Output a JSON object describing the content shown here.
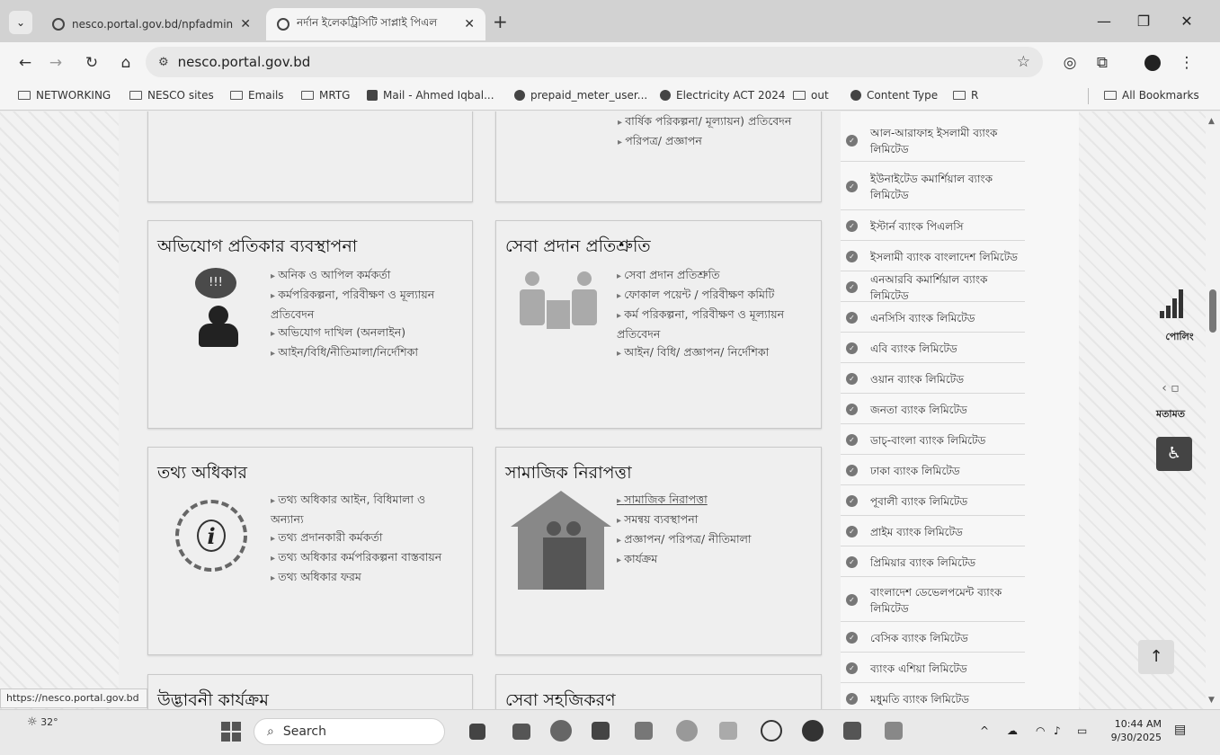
{
  "browser": {
    "tabs": [
      {
        "title": "nesco.portal.gov.bd/npfadmin/"
      },
      {
        "title": "নর্দান ইলেকট্রিসিটি সাপ্লাই পিএল"
      }
    ],
    "new_tab": "+",
    "address": "nesco.portal.gov.bd",
    "bookmarks": [
      "NETWORKING",
      "NESCO sites",
      "Emails",
      "MRTG",
      "Mail - Ahmed Iqbal...",
      "prepaid_meter_user...",
      "Electricity ACT 2024",
      "out",
      "Content Type",
      "R",
      "All Bookmarks"
    ],
    "status_url": "https://nesco.portal.gov.bd"
  },
  "page": {
    "card_top_mid_items": [
      "বার্ষিক পরিকল্পনা/ মূল্যায়ন) প্রতিবেদন",
      "পরিপত্র/ প্রজ্ঞাপন"
    ],
    "card_grievance": {
      "title": "অভিযোগ প্রতিকার ব্যবস্থাপনা",
      "items": [
        "অনিক ও আপিল কর্মকর্তা",
        "কর্মপরিকল্পনা, পরিবীক্ষণ ও মূল্যায়ন প্রতিবেদন",
        "অভিযোগ দাখিল (অনলাইন)",
        "আইন/বিধি/নীতিমালা/নির্দেশিকা"
      ]
    },
    "card_citizen_charter": {
      "title": "সেবা প্রদান প্রতিশ্রুতি",
      "items": [
        "সেবা প্রদান প্রতিশ্রুতি",
        "ফোকাল পয়েন্ট / পরিবীক্ষণ কমিটি",
        "কর্ম পরিকল্পনা, পরিবীক্ষণ ও মূল্যায়ন প্রতিবেদন",
        "আইন/ বিধি/ প্রজ্ঞাপন/ নির্দেশিকা"
      ]
    },
    "card_rti": {
      "title": "তথ্য অধিকার",
      "items": [
        "তথ্য অধিকার আইন, বিধিমালা ও অন্যান্য",
        "তথ্য প্রদানকারী কর্মকর্তা",
        "তথ্য অধিকার কর্মপরিকল্পনা বাস্তবায়ন",
        "তথ্য অধিকার ফরম"
      ]
    },
    "card_social_safety": {
      "title": "সামাজিক নিরাপত্তা",
      "items": [
        "সামাজিক নিরাপত্তা",
        "সমন্বয় ব্যবস্থাপনা",
        "প্রজ্ঞাপন/ পরিপত্র/ নীতিমালা",
        "কার্যক্রম"
      ]
    },
    "card_innovation": {
      "title": "উদ্ভাবনী কার্যক্রম"
    },
    "card_service_simplify": {
      "title": "সেবা সহজিকরণ"
    },
    "banks": [
      "আল-আরাফাহ ইসলামী ব্যাংক লিমিটেড",
      "ইউনাইটেড কমার্শিয়াল ব্যাংক লিমিটেড",
      "ইস্টার্ন ব্যাংক পিএলসি",
      "ইসলামী ব্যাংক বাংলাদেশ লিমিটেড",
      "এনআরবি কমার্শিয়াল ব্যাংক লিমিটেড",
      "এনসিসি ব্যাংক লিমিটেড",
      "এবি ব্যাংক লিমিটেড",
      "ওয়ান ব্যাংক লিমিটেড",
      "জনতা ব্যাংক লিমিটেড",
      "ডাচ্-বাংলা ব্যাংক লিমিটেড",
      "ঢাকা ব্যাংক লিমিটেড",
      "পূবালী ব্যাংক লিমিটেড",
      "প্রাইম ব্যাংক লিমিটেড",
      "প্রিমিয়ার ব্যাংক লিমিটেড",
      "বাংলাদেশ ডেভেলপমেন্ট ব্যাংক লিমিটেড",
      "বেসিক ব্যাংক লিমিটেড",
      "ব্যাংক এশিয়া লিমিটেড",
      "মধুমতি ব্যাংক লিমিটেড"
    ],
    "poll_label": "পোলিং",
    "opinion_label": "মতামত"
  },
  "taskbar": {
    "weather": "32°",
    "search_placeholder": "Search",
    "time": "10:44 AM",
    "date": "9/30/2025"
  }
}
